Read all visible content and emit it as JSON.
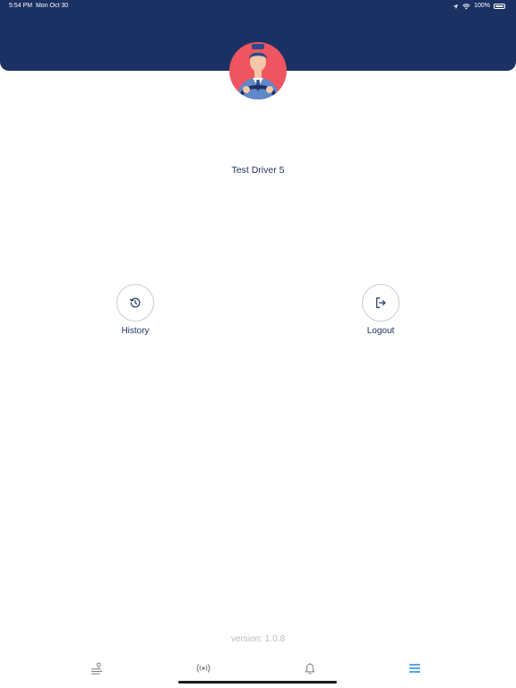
{
  "status_bar": {
    "time": "5:54 PM",
    "date": "Mon Oct 30",
    "battery": "100%",
    "battery_level": 1.0
  },
  "profile": {
    "name": "Test Driver 5"
  },
  "actions": [
    {
      "label": "History",
      "icon": "history-icon"
    },
    {
      "label": "Logout",
      "icon": "logout-icon"
    }
  ],
  "version": "version: 1.0.8",
  "tabbar": {
    "tabs": [
      {
        "icon": "route-icon",
        "active": false
      },
      {
        "icon": "broadcast-icon",
        "active": false
      },
      {
        "icon": "bell-icon",
        "active": false
      },
      {
        "icon": "menu-icon",
        "active": true
      }
    ]
  },
  "colors": {
    "header": "#1b3163",
    "accent": "#1e88e5",
    "text": "#1b2f5e",
    "muted": "#b9bcc3"
  }
}
